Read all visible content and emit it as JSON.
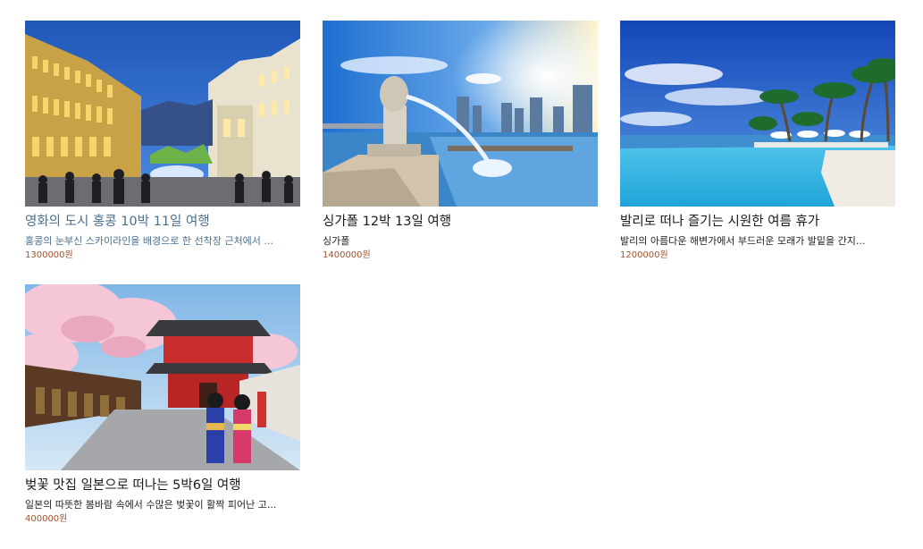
{
  "products": [
    {
      "title": "영화의 도시 홍콩 10박 11일 여행",
      "description": "홍콩의 눈부신 스카이라인을 배경으로 한 선착장 근처에서 ...",
      "price": "1300000원",
      "image": "hongkong-city-night-image"
    },
    {
      "title": "싱가폴 12박 13일 여행",
      "description": "싱가폴",
      "price": "1400000원",
      "image": "singapore-merlion-image"
    },
    {
      "title": "발리로 떠나 즐기는 시원한 여름 휴가",
      "description": "발리의 아름다운 해변가에서 부드러운 모래가 발밑을 간지...",
      "price": "1200000원",
      "image": "bali-beach-pool-image"
    },
    {
      "title": "벚꽃 맛집 일본으로 떠나는 5박6일 여행",
      "description": "일본의 따뜻한 봄바람 속에서 수많은 벚꽃이 활짝 피어난 고...",
      "price": "400000원",
      "image": "japan-cherry-blossom-temple-image"
    }
  ]
}
